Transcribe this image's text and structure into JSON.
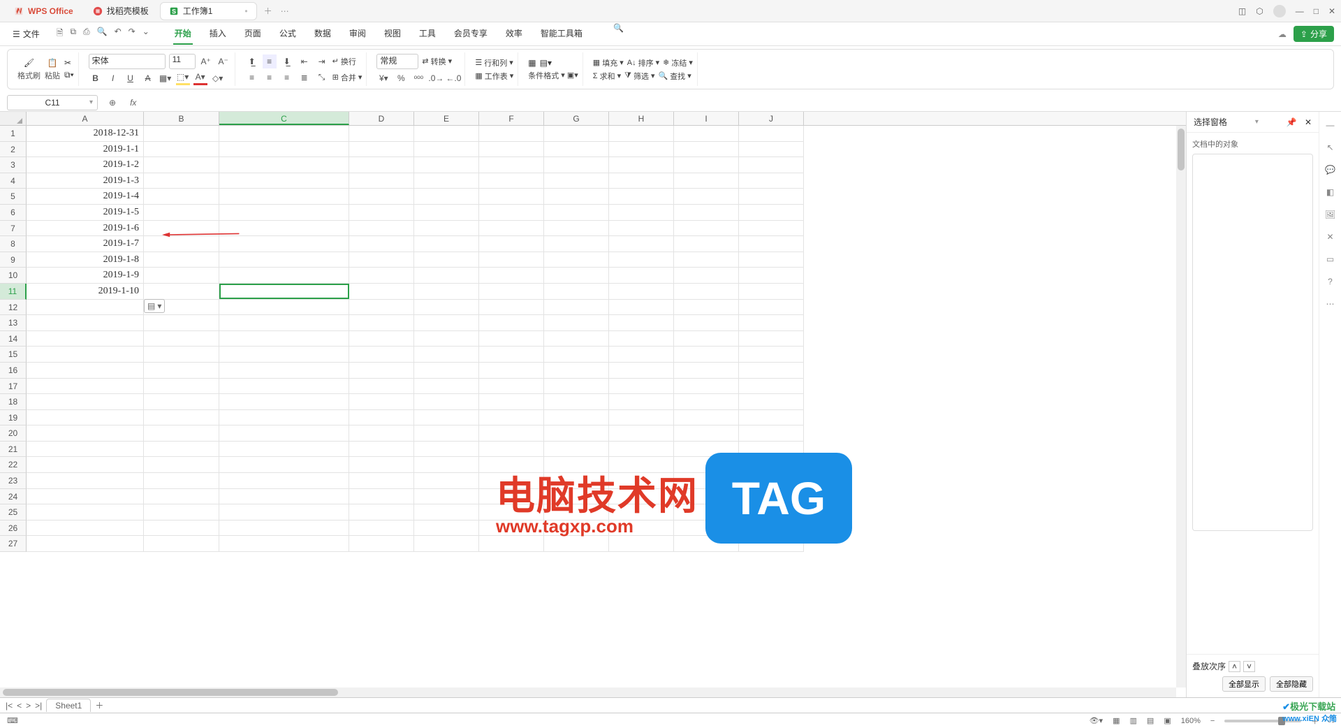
{
  "titlebar": {
    "app": "WPS Office",
    "docer": "找稻壳模板",
    "workbook": "工作簿1"
  },
  "menubar": {
    "file": "文件",
    "tabs": [
      "开始",
      "插入",
      "页面",
      "公式",
      "数据",
      "审阅",
      "视图",
      "工具",
      "会员专享",
      "效率",
      "智能工具箱"
    ],
    "share": "分享"
  },
  "ribbon": {
    "format_painter": "格式刷",
    "paste": "粘贴",
    "font_name": "宋体",
    "font_size": "11",
    "wrap": "换行",
    "number_format": "常规",
    "transform": "转换",
    "rowcol": "行和列",
    "worksheet": "工作表",
    "cond_format": "条件格式",
    "fill": "填充",
    "sort": "排序",
    "freeze": "冻结",
    "sum": "求和",
    "filter": "筛选",
    "find": "查找",
    "merge": "合并"
  },
  "namebox": "C11",
  "columns": [
    "A",
    "B",
    "C",
    "D",
    "E",
    "F",
    "G",
    "H",
    "I",
    "J"
  ],
  "col_A_data": [
    "2018-12-31",
    "2019-1-1",
    "2019-1-2",
    "2019-1-3",
    "2019-1-4",
    "2019-1-5",
    "2019-1-6",
    "2019-1-7",
    "2019-1-8",
    "2019-1-9",
    "2019-1-10"
  ],
  "row_count": 27,
  "right_panel": {
    "title": "选择窗格",
    "subtitle": "文档中的对象",
    "stack_order": "叠放次序",
    "show_all": "全部显示",
    "hide_all": "全部隐藏"
  },
  "sheettab": "Sheet1",
  "statusbar": {
    "zoom": "160%"
  },
  "watermark": {
    "t1": "电脑技术网",
    "t1b": "www.tagxp.com",
    "t2": "TAG",
    "t3a": "极光下载站",
    "t3b": "www.xiEN 众简"
  }
}
